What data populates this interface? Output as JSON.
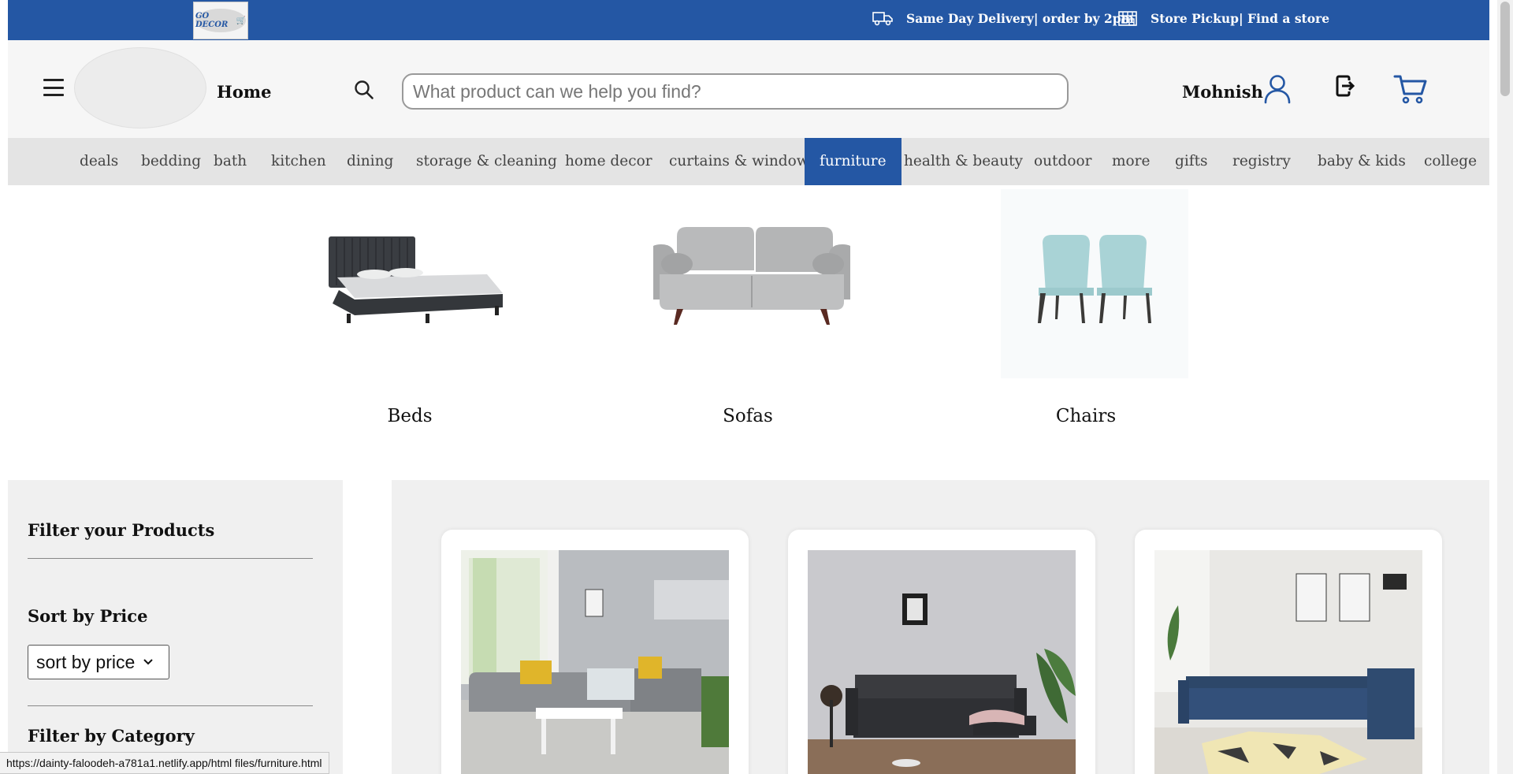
{
  "topbar": {
    "logo_text": "GO DECOR",
    "delivery_text": "Same Day Delivery| order by 2pm",
    "pickup_text": "Store Pickup| Find a store",
    "bg_color": "#2457a4"
  },
  "header": {
    "home_label": "Home",
    "search_placeholder": "What product can we help you find?",
    "search_value": "",
    "user_name": "Mohnish",
    "icons": [
      "menu-icon",
      "search-icon",
      "user-icon",
      "logout-icon",
      "cart-icon"
    ]
  },
  "nav": {
    "active": "furniture",
    "items": [
      "deals",
      "bedding",
      "bath",
      "kitchen",
      "dining",
      "storage & cleaning",
      "home decor",
      "curtains & window",
      "furniture",
      "health & beauty",
      "outdoor",
      "more",
      "gifts",
      "registry",
      "baby & kids",
      "college"
    ],
    "active_color": "#2457a4"
  },
  "categories": [
    {
      "label": "Beds",
      "image": "bed-image"
    },
    {
      "label": "Sofas",
      "image": "sofa-image"
    },
    {
      "label": "Chairs",
      "image": "chairs-image"
    }
  ],
  "sidebar": {
    "title": "Filter your Products",
    "sort_heading": "Sort by Price",
    "sort_value": "sort by price",
    "category_heading": "Filter by Category"
  },
  "products": [
    {
      "image": "grey-sectional-sofa-image"
    },
    {
      "image": "black-sofa-image"
    },
    {
      "image": "blue-corner-sofa-image"
    }
  ],
  "status_url": "https://dainty-faloodeh-a781a1.netlify.app/html files/furniture.html"
}
